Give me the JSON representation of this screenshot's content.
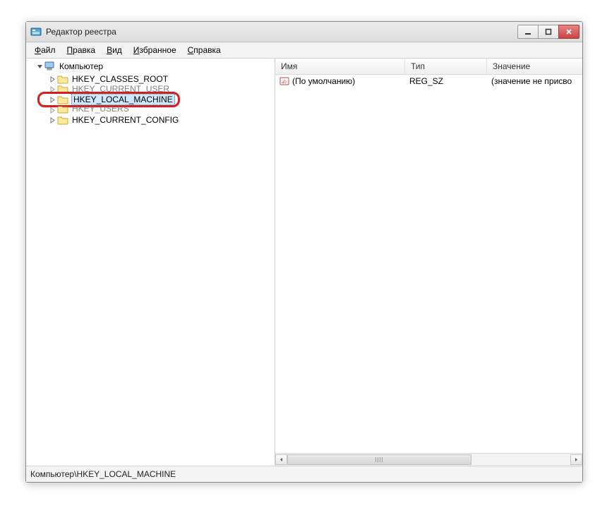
{
  "window": {
    "title": "Редактор реестра"
  },
  "menu": {
    "file": {
      "full": "Файл",
      "u": "Ф",
      "rest": "айл"
    },
    "edit": {
      "full": "Правка",
      "u": "П",
      "rest": "равка"
    },
    "view": {
      "full": "Вид",
      "u": "В",
      "rest": "ид"
    },
    "fav": {
      "full": "Избранное",
      "u": "И",
      "rest": "збранное"
    },
    "help": {
      "full": "Справка",
      "u": "С",
      "rest": "правка"
    }
  },
  "tree": {
    "root": "Компьютер",
    "hives": {
      "classes_root": "HKEY_CLASSES_ROOT",
      "current_user": "HKEY_CURRENT_USER",
      "local_machine": "HKEY_LOCAL_MACHINE",
      "users": "HKEY_USERS",
      "current_config": "HKEY_CURRENT_CONFIG"
    }
  },
  "list": {
    "headers": {
      "name": "Имя",
      "type": "Тип",
      "value": "Значение"
    },
    "rows": [
      {
        "name": "(По умолчанию)",
        "type": "REG_SZ",
        "value": "(значение не присво"
      }
    ]
  },
  "statusbar": "Компьютер\\HKEY_LOCAL_MACHINE"
}
